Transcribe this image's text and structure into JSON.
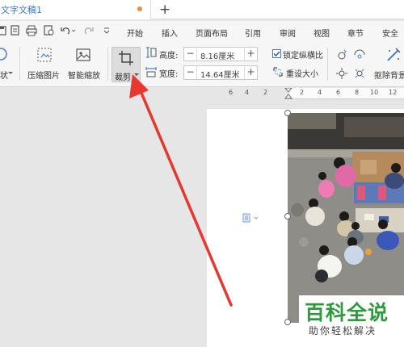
{
  "tab": {
    "title": "文字文稿1",
    "new_tab": "+"
  },
  "menu": {
    "items": [
      "开始",
      "插入",
      "页面布局",
      "引用",
      "审阅",
      "视图",
      "章节",
      "安全"
    ]
  },
  "ribbon": {
    "shape_label": "状",
    "compress_label": "压缩图片",
    "smart_scale_label": "智能缩放",
    "crop_label": "裁剪",
    "height_label": "高度:",
    "height_value": "8.16厘米",
    "width_label": "宽度:",
    "width_value": "14.64厘米",
    "lock_ratio_label": "锁定纵横比",
    "reset_size_label": "重设大小",
    "remove_bg_label": "抠除背景"
  },
  "ruler": {
    "ticks": [
      "6",
      "4",
      "2",
      "2",
      "4",
      "6",
      "8",
      "10",
      "12"
    ]
  },
  "watermark": {
    "title": "百科全说",
    "subtitle": "助你轻松解决"
  },
  "colors": {
    "accent_blue": "#3a79d8",
    "arrow_red": "#e8372f",
    "watermark_green": "#2e9a3e"
  }
}
